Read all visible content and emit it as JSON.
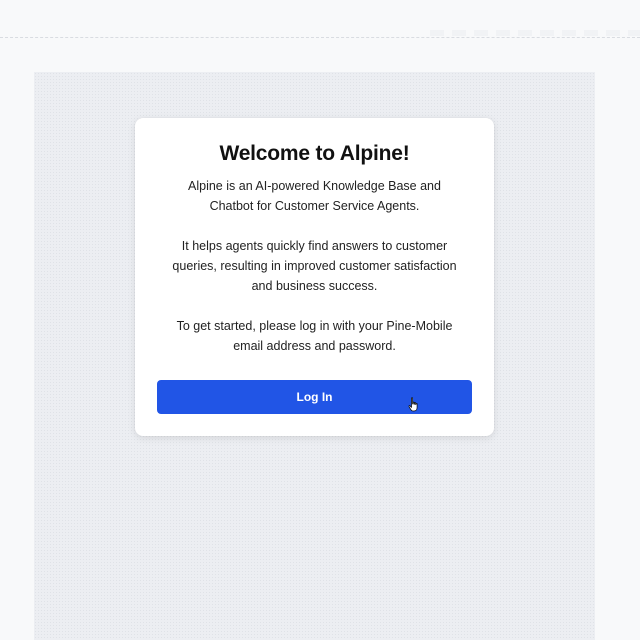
{
  "welcome": {
    "title": "Welcome to Alpine!",
    "intro_line1": "Alpine is an AI-powered Knowledge Base and",
    "intro_line2": "Chatbot for Customer Service Agents.",
    "help_line1": "It helps agents quickly find answers to customer",
    "help_line2": "queries, resulting in improved customer satisfaction",
    "help_line3": "and business success.",
    "start_line1": "To get started, please log in with your Pine-Mobile",
    "start_line2": "email address and password.",
    "login_label": "Log In"
  },
  "colors": {
    "accent": "#2155e6",
    "background": "#eceef2",
    "card": "#ffffff"
  },
  "icons": {
    "cursor": "hand-pointer-icon"
  }
}
